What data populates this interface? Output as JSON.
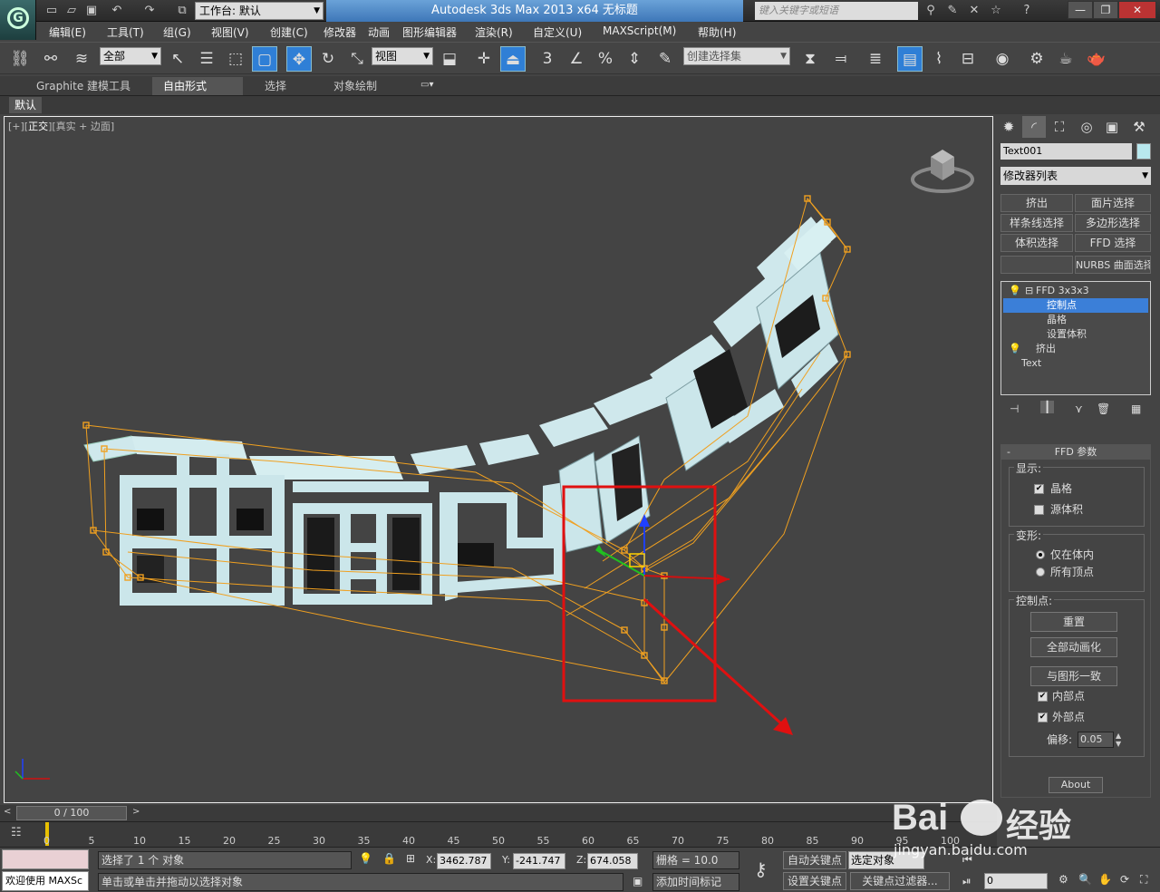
{
  "titlebar": {
    "workspace": "工作台: 默认",
    "app_title": "Autodesk 3ds Max  2013 x64      无标题",
    "search_placeholder": "键入关键字或短语"
  },
  "menubar": [
    "编辑(E)",
    "工具(T)",
    "组(G)",
    "视图(V)",
    "创建(C)",
    "修改器",
    "动画",
    "图形编辑器",
    "渲染(R)",
    "自定义(U)",
    "MAXScript(M)",
    "帮助(H)"
  ],
  "toolbar": {
    "selection_filter": "全部",
    "ref_coord": "视图",
    "named_selection": "创建选择集",
    "snap_angle": "3",
    "percent_snap": "%"
  },
  "ribbon": {
    "tabs": [
      "Graphite 建模工具",
      "自由形式",
      "选择",
      "对象绘制"
    ],
    "active_tab": "自由形式",
    "sub_tab": "默认"
  },
  "viewport": {
    "label_prefix": "[+][",
    "label_view": "正交",
    "label_shading": "][真实 + 边面]",
    "text_content": "曲面凹陷文字"
  },
  "command_panel": {
    "object_name": "Text001",
    "modifier_list": "修改器列表",
    "modifier_buttons": [
      "挤出",
      "面片选择",
      "样条线选择",
      "多边形选择",
      "体积选择",
      "FFD 选择",
      "",
      "NURBS 曲面选择"
    ],
    "stack": [
      {
        "label": "FFD 3x3x3",
        "level": 0,
        "selected": false
      },
      {
        "label": "控制点",
        "level": 2,
        "selected": true
      },
      {
        "label": "晶格",
        "level": 2,
        "selected": false
      },
      {
        "label": "设置体积",
        "level": 2,
        "selected": false
      },
      {
        "label": "挤出",
        "level": 0,
        "selected": false
      },
      {
        "label": "Text",
        "level": 1,
        "selected": false
      }
    ],
    "rollout_title": "FFD 参数",
    "display_group": "显示:",
    "lattice_label": "晶格",
    "source_volume_label": "源体积",
    "deform_group": "变形:",
    "only_in_volume": "仅在体内",
    "all_vertices": "所有顶点",
    "control_points_group": "控制点:",
    "reset_button": "重置",
    "animate_all_button": "全部动画化",
    "conform_button": "与图形一致",
    "inside_points": "内部点",
    "outside_points": "外部点",
    "offset_label": "偏移:",
    "offset_value": "0.05",
    "about_button": "About"
  },
  "timeline": {
    "frame_display": "0 / 100",
    "ticks": [
      "0",
      "5",
      "10",
      "15",
      "20",
      "25",
      "30",
      "35",
      "40",
      "45",
      "50",
      "55",
      "60",
      "65",
      "70",
      "75",
      "80",
      "85",
      "90",
      "95",
      "100"
    ]
  },
  "status": {
    "maxscript_label": "欢迎使用  MAXSc",
    "selection_info": "选择了 1 个 对象",
    "prompt": "单击或单击并拖动以选择对象",
    "x_label": "X:",
    "x_value": "3462.787",
    "y_label": "Y:",
    "y_value": "-241.747",
    "z_label": "Z:",
    "z_value": "674.058",
    "grid": "栅格 = 10.0",
    "add_time_tag": "添加时间标记",
    "auto_key": "自动关键点",
    "set_key": "设置关键点",
    "key_mode": "选定对象",
    "key_filters": "关键点过滤器...",
    "frame_value": "0"
  },
  "watermark": {
    "brand": "Bai",
    "brand_suffix": "经验",
    "url": "jingyan.baidu.com"
  },
  "colors": {
    "highlight": "#3b7fd8",
    "lattice": "#f0a020",
    "annotation": "#e01010",
    "text_face": "#c8e8ec"
  }
}
